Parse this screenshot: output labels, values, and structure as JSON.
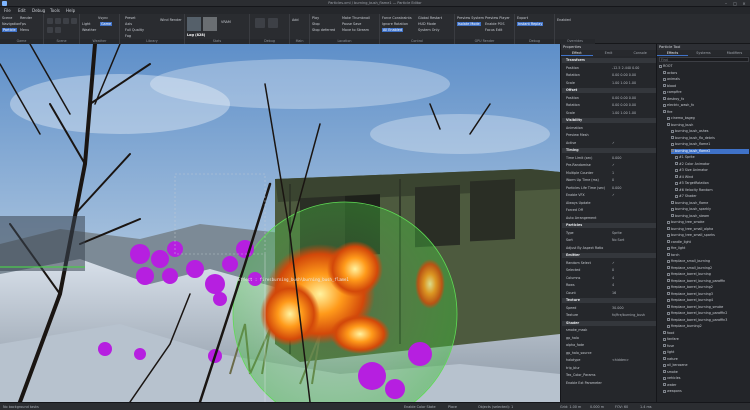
{
  "titlebar": {
    "title": "Particles.xml / burning_bush_flame1 — Particle Editor"
  },
  "menu": [
    "File",
    "Edit",
    "Debug",
    "Tools",
    "Help"
  ],
  "ribbon": {
    "scene_label": "Scene",
    "navigation_label": "Navigation",
    "particle_label": "Particle",
    "render_label": "Render",
    "fps_label": "Fps",
    "menu_label": "Menu",
    "vsync_label": "Vsync",
    "light_label": "Light",
    "game_label": "Game",
    "preset_label": "Preset",
    "axis_label": "Axis",
    "wind_label": "Wind Render",
    "mode_label": "Mode",
    "particle_fx": "Particle FX",
    "weather_label": "Weather",
    "full_quality": "Full Quality",
    "fog_label": "Fog",
    "log_label": "Log (828)",
    "vram_label": "VRAM",
    "add_label": "Add",
    "play_label": "Play",
    "make_thumb": "Make Thumbnail",
    "force_cons": "Force Constraints",
    "global_restart": "Global Restart",
    "preview_system": "Preview System",
    "preview_player": "Preview Player",
    "export_label": "Export",
    "stop_label": "Stop",
    "pause_save": "Pause Save",
    "ignore_rotation": "Ignore Rotation",
    "hud_mode": "HUD Mode",
    "isolate_mode": "Isolate Mode",
    "enable_pos": "Enable POS",
    "to_restart": "Restart",
    "stop_deferred": "Stop deferred",
    "move_to_stream": "Move to Stream",
    "all_enabled": "All Enabled",
    "system_only": "System Only",
    "focus_edit": "Focus Edit",
    "instant_replay": "Instant Replay",
    "enabled_label": "Enabled",
    "groups": [
      "Game",
      "Scene",
      "Weather",
      "Library",
      "Stats",
      "Debug",
      "Main",
      "Location",
      "Edit Files",
      "Control",
      "GPU Render",
      "Debug",
      "Overrides"
    ]
  },
  "viewport": {
    "effect_label": "Effect : firesburning_bush\\burning_bush_flame1"
  },
  "properties": {
    "title": "Properties",
    "tabs": [
      "Effect",
      "Emit",
      "Console"
    ],
    "rows": [
      {
        "type": "sec",
        "label": "Transform"
      },
      {
        "label": "Position",
        "value": "-12.5  2.440  0.00"
      },
      {
        "label": "Rotation",
        "value": "0.00  0.00  0.00"
      },
      {
        "label": "Scale",
        "value": "1.00  1.00  1.00"
      },
      {
        "type": "sec",
        "label": "Offset"
      },
      {
        "label": "Position",
        "value": "0.00  0.00  0.00"
      },
      {
        "label": "Rotation",
        "value": "0.00  0.00  0.00"
      },
      {
        "label": "Scale",
        "value": "1.00  1.00  1.00"
      },
      {
        "type": "sec",
        "label": "Visibility"
      },
      {
        "label": "Animation",
        "value": ""
      },
      {
        "label": "Preview Mesh",
        "value": ""
      },
      {
        "label": "Active",
        "value": "✓"
      },
      {
        "type": "sec",
        "label": "Timing"
      },
      {
        "label": "Time Limit (sec)",
        "value": "0.000"
      },
      {
        "label": "Pre-Randomise",
        "value": "✓"
      },
      {
        "label": "Multiple Counter",
        "value": "1"
      },
      {
        "label": "Warm Up Time (ms)",
        "value": "0"
      },
      {
        "label": "Particles Life Time (sec)",
        "value": "0.000"
      },
      {
        "label": "Enable VFX",
        "value": "✓"
      },
      {
        "label": "Always Update",
        "value": ""
      },
      {
        "label": "Forced Off",
        "value": ""
      },
      {
        "label": "Auto Arrangement",
        "value": ""
      },
      {
        "type": "sec",
        "label": "Particles"
      },
      {
        "label": "Type",
        "value": "Sprite"
      },
      {
        "label": "Sort",
        "value": "No Sort"
      },
      {
        "label": "Adjust By Aspect Ratio",
        "value": ""
      },
      {
        "type": "sec",
        "label": "Emitter"
      },
      {
        "label": "Random Select",
        "value": "✓"
      },
      {
        "label": "Selected",
        "value": "0"
      },
      {
        "label": "Columns",
        "value": "4"
      },
      {
        "label": "Rows",
        "value": "4"
      },
      {
        "label": "Count",
        "value": "16"
      },
      {
        "type": "sec",
        "label": "Texture"
      },
      {
        "label": "Speed",
        "value": "30.000"
      },
      {
        "label": "Texture",
        "value": "fx/fire/burning_bush"
      },
      {
        "type": "sec",
        "label": "Shader"
      },
      {
        "label": "smoke_mask",
        "value": ""
      },
      {
        "label": "gp_halo",
        "value": ""
      },
      {
        "label": "alpha_fade",
        "value": ""
      },
      {
        "label": "gp_halo_source",
        "value": ""
      },
      {
        "label": "halotype",
        "value": "<hidden>"
      },
      {
        "label": "trip_blur",
        "value": ""
      },
      {
        "label": "Tex_Color_Params",
        "value": ""
      },
      {
        "label": "Enable Ext Parameter",
        "value": ""
      }
    ]
  },
  "particle_tool": {
    "title": "Particle Tool",
    "tabs": [
      "Effects",
      "Systems",
      "Modifiers"
    ],
    "search_placeholder": "Find",
    "items": [
      {
        "label": "ROOT",
        "depth": 0
      },
      {
        "label": "actors",
        "depth": 1
      },
      {
        "label": "animals",
        "depth": 1
      },
      {
        "label": "blood",
        "depth": 1
      },
      {
        "label": "campfire",
        "depth": 1
      },
      {
        "label": "destroy_fx",
        "depth": 1
      },
      {
        "label": "electric_wash_fx",
        "depth": 1
      },
      {
        "label": "fire",
        "depth": 1
      },
      {
        "label": "cinema_bsgeg",
        "depth": 2
      },
      {
        "label": "burning_bush",
        "depth": 2
      },
      {
        "label": "burning_bush_ashes",
        "depth": 3
      },
      {
        "label": "burning_bush_flo_debris",
        "depth": 3
      },
      {
        "label": "burning_bush_flame1",
        "depth": 3
      },
      {
        "label": "burning_bush_flame2",
        "depth": 3,
        "selected": true
      },
      {
        "label": "#1 Sprite",
        "depth": 4
      },
      {
        "label": "#2 Color Animator",
        "depth": 4
      },
      {
        "label": "#3 Size Animator",
        "depth": 4
      },
      {
        "label": "#4 Wind",
        "depth": 4
      },
      {
        "label": "#5 TargetRotation",
        "depth": 4
      },
      {
        "label": "#6 Velocity Random",
        "depth": 4
      },
      {
        "label": "#7 Shader",
        "depth": 4
      },
      {
        "label": "burning_bush_flame",
        "depth": 3
      },
      {
        "label": "burning_bush_sparkly",
        "depth": 3
      },
      {
        "label": "burning_bush_steam",
        "depth": 3
      },
      {
        "label": "burning_tree_smoke",
        "depth": 2
      },
      {
        "label": "burning_tree_small_alpha",
        "depth": 2
      },
      {
        "label": "burning_tree_small_sparks",
        "depth": 2
      },
      {
        "label": "candle_light",
        "depth": 2
      },
      {
        "label": "fire_light",
        "depth": 2
      },
      {
        "label": "torch",
        "depth": 2
      },
      {
        "label": "fireplace_small_burning",
        "depth": 2
      },
      {
        "label": "fireplace_small_burning2",
        "depth": 2
      },
      {
        "label": "fireplace_barrel_burning",
        "depth": 2
      },
      {
        "label": "fireplace_barrel_burning_paraffin",
        "depth": 2
      },
      {
        "label": "fireplace_barrel_burning2",
        "depth": 2
      },
      {
        "label": "fireplace_barrel_burning3",
        "depth": 2
      },
      {
        "label": "fireplace_barrel_burning4",
        "depth": 2
      },
      {
        "label": "fireplace_barrel_burning_smoke",
        "depth": 2
      },
      {
        "label": "fireplace_barrel_burning_paraffin2",
        "depth": 2
      },
      {
        "label": "fireplace_barrel_burning_paraffin3",
        "depth": 2
      },
      {
        "label": "fireplace_burning2",
        "depth": 2
      },
      {
        "label": "food",
        "depth": 1
      },
      {
        "label": "fanfare",
        "depth": 1
      },
      {
        "label": "fuse",
        "depth": 1
      },
      {
        "label": "light",
        "depth": 1
      },
      {
        "label": "nature",
        "depth": 1
      },
      {
        "label": "oil_kerosene",
        "depth": 1
      },
      {
        "label": "smoke",
        "depth": 1
      },
      {
        "label": "vehicles",
        "depth": 1
      },
      {
        "label": "water",
        "depth": 1
      },
      {
        "label": "weapons",
        "depth": 1
      }
    ]
  },
  "status": {
    "left": "No background tasks",
    "sel": "Enable Color State",
    "mode": "Place",
    "objects": "Objects (selected): 1",
    "grid": "Grid: 1.00 m",
    "coords": "0.000 m",
    "fov": "FOV: 60",
    "perf": "1.4 ms"
  },
  "colors": {
    "accent": "#3f72c8",
    "panel": "#25272b",
    "selection": "#3f72c8"
  }
}
